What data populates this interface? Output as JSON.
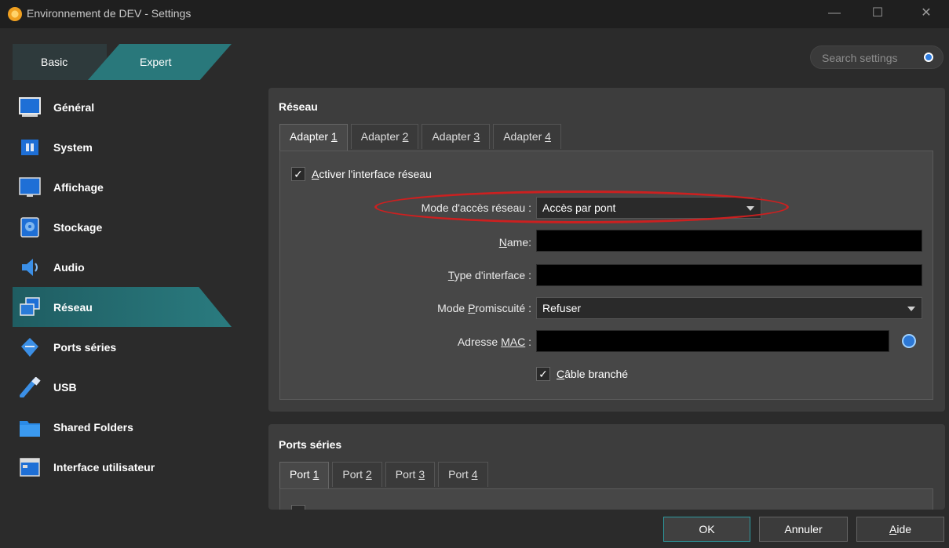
{
  "window": {
    "title": "Environnement de DEV - Settings",
    "controls": {
      "minimize": "—",
      "maximize": "☐",
      "close": "✕"
    }
  },
  "mode_switch": {
    "basic": "Basic",
    "expert": "Expert"
  },
  "search": {
    "placeholder": "Search settings"
  },
  "sidebar": {
    "items": [
      {
        "label": "Général",
        "icon": "monitor-icon"
      },
      {
        "label": "System",
        "icon": "chip-icon"
      },
      {
        "label": "Affichage",
        "icon": "display-icon"
      },
      {
        "label": "Stockage",
        "icon": "disk-icon"
      },
      {
        "label": "Audio",
        "icon": "speaker-icon"
      },
      {
        "label": "Réseau",
        "icon": "network-icon",
        "active": true
      },
      {
        "label": "Ports séries",
        "icon": "serial-port-icon"
      },
      {
        "label": "USB",
        "icon": "usb-icon"
      },
      {
        "label": "Shared Folders",
        "icon": "folder-icon"
      },
      {
        "label": "Interface utilisateur",
        "icon": "window-icon"
      }
    ]
  },
  "network": {
    "section_title": "Réseau",
    "tabs": [
      {
        "prefix": "Adapter ",
        "mnemonic": "1"
      },
      {
        "prefix": "Adapter ",
        "mnemonic": "2"
      },
      {
        "prefix": "Adapter ",
        "mnemonic": "3"
      },
      {
        "prefix": "Adapter ",
        "mnemonic": "4"
      }
    ],
    "enable_interface": {
      "checked": true,
      "mnemonic": "A",
      "rest": "ctiver l'interface réseau"
    },
    "access_mode": {
      "label": "Mode d'accès réseau :",
      "value": "Accès par pont"
    },
    "name": {
      "mnemonic": "N",
      "rest": "ame:"
    },
    "interface_type": {
      "mnemonic": "T",
      "rest": "ype d'interface :"
    },
    "promiscuous": {
      "prefix": "Mode ",
      "mnemonic": "P",
      "rest": "romiscuité :",
      "value": "Refuser"
    },
    "mac": {
      "prefix": "Adresse ",
      "mnemonic": "MAC",
      "rest": " :"
    },
    "cable": {
      "checked": true,
      "mnemonic": "C",
      "rest": "âble branché"
    }
  },
  "serial": {
    "section_title": "Ports séries",
    "tabs": [
      {
        "prefix": "Port ",
        "mnemonic": "1"
      },
      {
        "prefix": "Port ",
        "mnemonic": "2"
      },
      {
        "prefix": "Port ",
        "mnemonic": "3"
      },
      {
        "prefix": "Port ",
        "mnemonic": "4"
      }
    ]
  },
  "buttons": {
    "ok": "OK",
    "cancel": "Annuler",
    "help": {
      "mnemonic": "A",
      "rest": "ide"
    }
  },
  "colors": {
    "accent": "#29787b",
    "highlight_ellipse": "#cc2020",
    "background": "#2b2b2b",
    "panel": "#3d3d3d"
  }
}
